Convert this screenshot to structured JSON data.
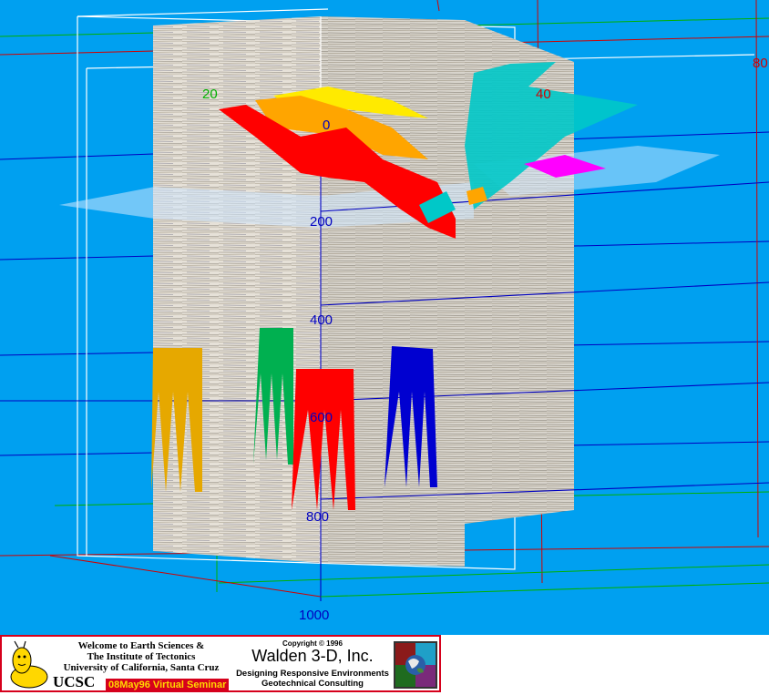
{
  "viewer": {
    "background_color": "#00a0f0",
    "axis_labels": [
      "20",
      "40",
      "80"
    ],
    "depth_labels": [
      "0",
      "200",
      "400",
      "600",
      "800",
      "1000"
    ]
  },
  "surfaces": {
    "horizon_colors": [
      "#ff0000",
      "#ffa500",
      "#ffea00",
      "#00c8c8",
      "#ff00ff"
    ],
    "well_bundle_colors": [
      "#e6a800",
      "#00b050",
      "#ff0000",
      "#0000ff"
    ]
  },
  "footer": {
    "welcome_lines": [
      "Welcome to Earth Sciences &",
      "The Institute of Tectonics",
      "University of California, Santa Cruz"
    ],
    "ucsc": "UCSC",
    "seminar": "08May96 Virtual Seminar",
    "copyright": "Copyright © 1996",
    "company": "Walden 3-D, Inc.",
    "tagline_1": "Designing Responsive Environments",
    "tagline_2": "Geotechnical Consulting",
    "icons": [
      "slug-mascot-icon",
      "earth-globe-icon"
    ]
  }
}
